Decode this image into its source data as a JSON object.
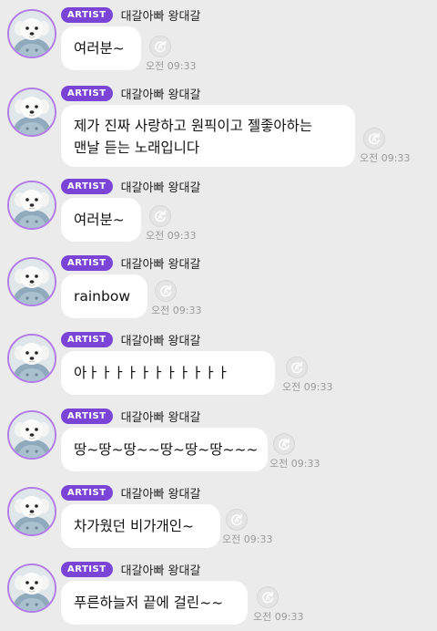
{
  "badge_label": "ARTIST",
  "sender_name": "대갈아빠 왕대갈",
  "colors": {
    "background": "#ebebeb",
    "badge": "#7a45d6",
    "avatar_ring": "#b27be6",
    "bubble": "#ffffff",
    "time_text": "#9a9a9a"
  },
  "icons": {
    "avatar": "avatar-photo",
    "reaction": "reaction-rotate-icon"
  },
  "messages": [
    {
      "lines": [
        "여러분~"
      ],
      "time": "오전 09:33"
    },
    {
      "lines": [
        "제가 진짜 사랑하고 원픽이고 젤좋아하는",
        "맨날 듣는 노래입니다"
      ],
      "time": "오전 09:33"
    },
    {
      "lines": [
        "여러분~"
      ],
      "time": "오전 09:33"
    },
    {
      "lines": [
        "rainbow"
      ],
      "time": "오전 09:33"
    },
    {
      "lines": [
        "아ㅏㅏㅏㅏㅏㅏㅏㅏㅏㅏㅏ"
      ],
      "time": "오전 09:33"
    },
    {
      "lines": [
        "땅~땅~땅~~땅~땅~땅~~~"
      ],
      "time": "오전 09:33"
    },
    {
      "lines": [
        "차가웠던 비가개인~"
      ],
      "time": "오전 09:33"
    },
    {
      "lines": [
        "푸른하늘저 끝에 걸린~~"
      ],
      "time": "오전 09:33"
    }
  ]
}
